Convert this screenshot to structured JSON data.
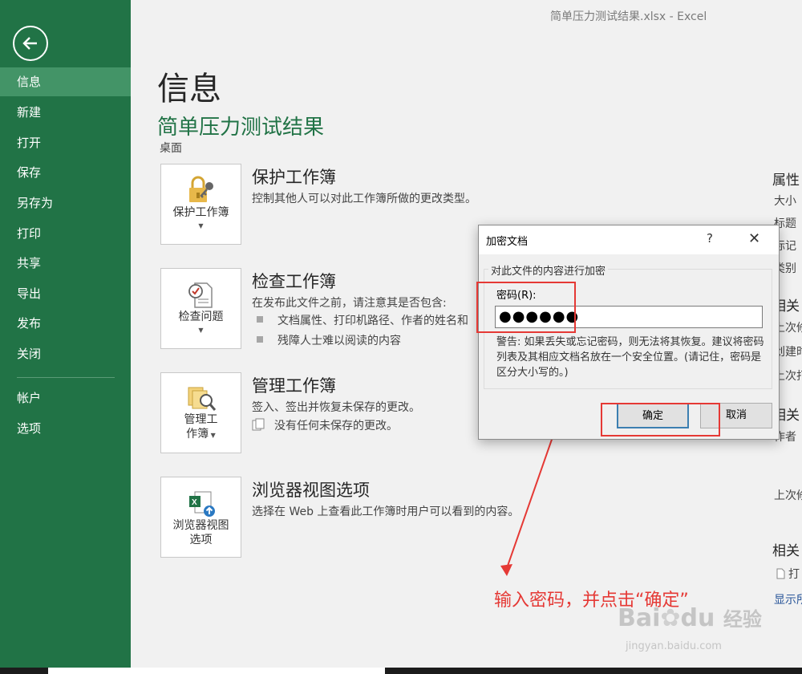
{
  "window_title": "简单压力测试结果.xlsx - Excel",
  "sidebar": {
    "back_icon": "back-arrow-icon",
    "items": [
      {
        "label": "信息",
        "active": true
      },
      {
        "label": "新建"
      },
      {
        "label": "打开"
      },
      {
        "label": "保存"
      },
      {
        "label": "另存为"
      },
      {
        "label": "打印"
      },
      {
        "label": "共享"
      },
      {
        "label": "导出"
      },
      {
        "label": "发布"
      },
      {
        "label": "关闭"
      },
      {
        "label": "帐户"
      },
      {
        "label": "选项"
      }
    ]
  },
  "page": {
    "title": "信息",
    "file_name": "简单压力测试结果",
    "file_location": "桌面"
  },
  "sections": [
    {
      "tile_label": "保护工作簿",
      "icon": "lock-key-icon",
      "title": "保护工作簿",
      "description": "控制其他人可以对此工作簿所做的更改类型。"
    },
    {
      "tile_label": "检查问题",
      "icon": "inspect-document-icon",
      "title": "检查工作簿",
      "description": "在发布此文件之前，请注意其是否包含:",
      "bullets": [
        "文档属性、打印机路径、作者的姓名和",
        "残障人士难以阅读的内容"
      ]
    },
    {
      "tile_label_line1": "管理工",
      "tile_label_line2": "作簿",
      "icon": "manage-workbook-icon",
      "title": "管理工作簿",
      "description": "签入、签出并恢复未保存的更改。",
      "sub_item": "没有任何未保存的更改。"
    },
    {
      "tile_label_line1": "浏览器视图",
      "tile_label_line2": "选项",
      "icon": "browser-view-icon",
      "title": "浏览器视图选项",
      "description": "选择在 Web 上查看此工作簿时用户可以看到的内容。"
    }
  ],
  "right_column": {
    "properties_heading": "属性",
    "size": "大小",
    "title": "标题",
    "tags": "标记",
    "category": "类别",
    "related_dates": "相关",
    "last_modified": "上次修",
    "created": "创建时",
    "last_printed": "上次打",
    "related_people": "相关",
    "author": "作者",
    "last_modified_by": "上次修",
    "related_docs": "相关",
    "open_file": "打",
    "show_all": "显示所"
  },
  "dialog": {
    "title": "加密文档",
    "help": "?",
    "close": "✕",
    "group_label": "对此文件的内容进行加密",
    "password_label": "密码(R):",
    "password_value": "●●●●●●",
    "warning": "警告: 如果丢失或忘记密码，则无法将其恢复。建议将密码列表及其相应文档名放在一个安全位置。(请记住，密码是区分大小写的。)",
    "ok": "确定",
    "cancel": "取消"
  },
  "annotation": "输入密码，并点击“确定”",
  "watermark": {
    "brand": "Bai",
    "brand2": "du",
    "suffix": "经验",
    "url": "jingyan.baidu.com"
  },
  "colors": {
    "sidebar": "#217346",
    "sidebar_active": "#439467",
    "accent_green": "#217346",
    "highlight_red": "#e53935",
    "ok_border": "#3c7fb1"
  }
}
